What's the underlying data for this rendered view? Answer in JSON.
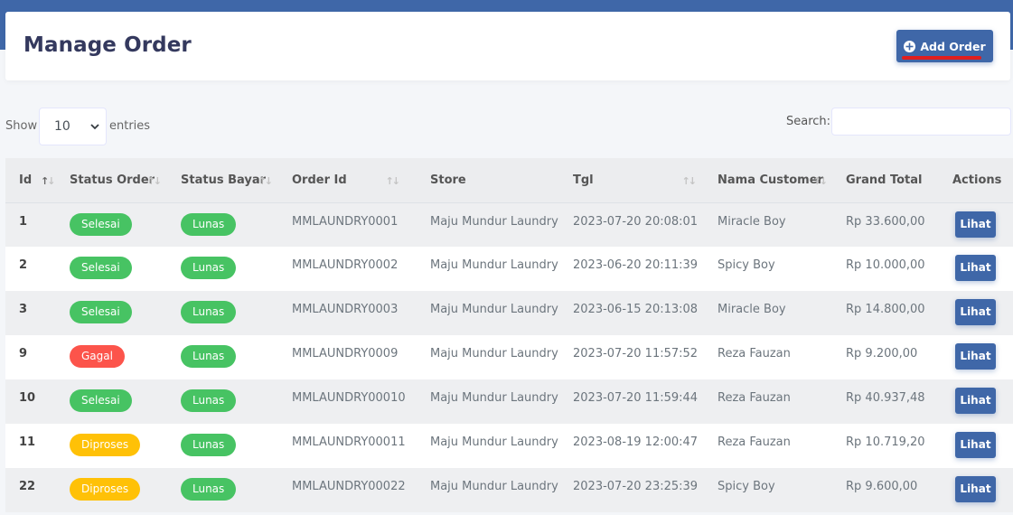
{
  "header": {
    "title": "Manage Order",
    "add_button": "Add Order"
  },
  "controls": {
    "show_label": "Show",
    "entries_value": "10",
    "entries_label": "entries",
    "search_label": "Search:",
    "search_value": ""
  },
  "table": {
    "columns": [
      {
        "label": "Id",
        "sortable": true,
        "sort": "asc"
      },
      {
        "label": "Status Order",
        "sortable": true,
        "sort": "none"
      },
      {
        "label": "Status Bayar",
        "sortable": true,
        "sort": "none"
      },
      {
        "label": "Order Id",
        "sortable": true,
        "sort": "none"
      },
      {
        "label": "Store",
        "sortable": false,
        "sort": "none"
      },
      {
        "label": "Tgl",
        "sortable": true,
        "sort": "none"
      },
      {
        "label": "Nama Customer",
        "sortable": true,
        "sort": "none"
      },
      {
        "label": "Grand Total",
        "sortable": false,
        "sort": "none"
      },
      {
        "label": "Actions",
        "sortable": false,
        "sort": "none"
      }
    ],
    "rows": [
      {
        "id": "1",
        "status_order": "Selesai",
        "status_order_type": "selesai",
        "status_bayar": "Lunas",
        "order_id": "MMLAUNDRY0001",
        "store": "Maju Mundur Laundry",
        "tgl": "2023-07-20 20:08:01",
        "customer": "Miracle Boy",
        "total": "Rp 33.600,00",
        "action": "Lihat"
      },
      {
        "id": "2",
        "status_order": "Selesai",
        "status_order_type": "selesai",
        "status_bayar": "Lunas",
        "order_id": "MMLAUNDRY0002",
        "store": "Maju Mundur Laundry",
        "tgl": "2023-06-20 20:11:39",
        "customer": "Spicy Boy",
        "total": "Rp 10.000,00",
        "action": "Lihat"
      },
      {
        "id": "3",
        "status_order": "Selesai",
        "status_order_type": "selesai",
        "status_bayar": "Lunas",
        "order_id": "MMLAUNDRY0003",
        "store": "Maju Mundur Laundry",
        "tgl": "2023-06-15 20:13:08",
        "customer": "Miracle Boy",
        "total": "Rp 14.800,00",
        "action": "Lihat"
      },
      {
        "id": "9",
        "status_order": "Gagal",
        "status_order_type": "gagal",
        "status_bayar": "Lunas",
        "order_id": "MMLAUNDRY0009",
        "store": "Maju Mundur Laundry",
        "tgl": "2023-07-20 11:57:52",
        "customer": "Reza Fauzan",
        "total": "Rp 9.200,00",
        "action": "Lihat"
      },
      {
        "id": "10",
        "status_order": "Selesai",
        "status_order_type": "selesai",
        "status_bayar": "Lunas",
        "order_id": "MMLAUNDRY00010",
        "store": "Maju Mundur Laundry",
        "tgl": "2023-07-20 11:59:44",
        "customer": "Reza Fauzan",
        "total": "Rp 40.937,48",
        "action": "Lihat"
      },
      {
        "id": "11",
        "status_order": "Diproses",
        "status_order_type": "diproses",
        "status_bayar": "Lunas",
        "order_id": "MMLAUNDRY00011",
        "store": "Maju Mundur Laundry",
        "tgl": "2023-08-19 12:00:47",
        "customer": "Reza Fauzan",
        "total": "Rp 10.719,20",
        "action": "Lihat"
      },
      {
        "id": "22",
        "status_order": "Diproses",
        "status_order_type": "diproses",
        "status_bayar": "Lunas",
        "order_id": "MMLAUNDRY00022",
        "store": "Maju Mundur Laundry",
        "tgl": "2023-07-20 23:25:39",
        "customer": "Spicy Boy",
        "total": "Rp 9.600,00",
        "action": "Lihat"
      }
    ]
  },
  "colors": {
    "primary": "#3f67a8",
    "success": "#47c363",
    "danger": "#fc544b",
    "warning": "#ffc107"
  },
  "icons": {
    "add_button_icon": "plus-circle-icon",
    "select_icon": "chevron-down-icon",
    "sort_icon": "sort-arrows-icon"
  }
}
